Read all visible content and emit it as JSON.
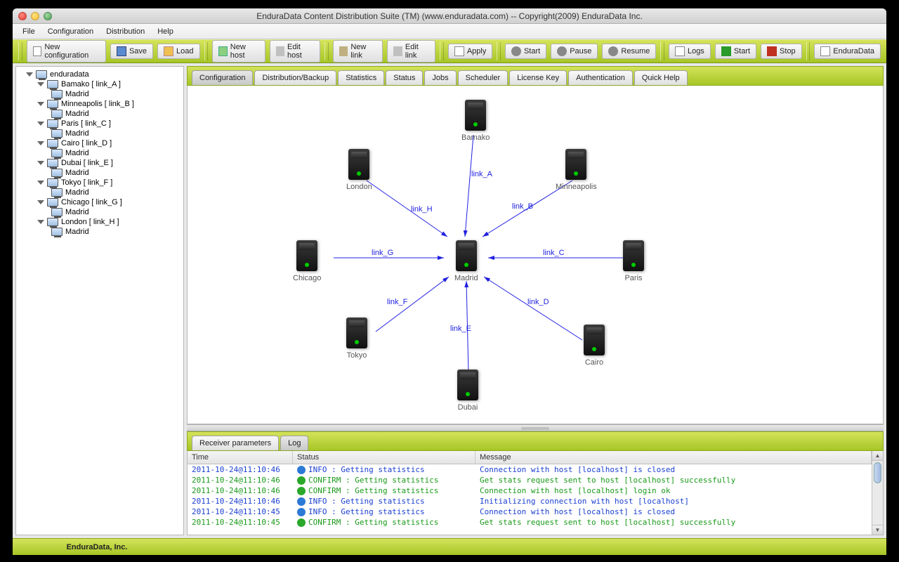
{
  "window": {
    "title": "EnduraData Content Distribution Suite (TM) (www.enduradata.com) -- Copyright(2009) EnduraData Inc."
  },
  "menu": {
    "file": "File",
    "configuration": "Configuration",
    "distribution": "Distribution",
    "help": "Help"
  },
  "toolbar": {
    "new_config": "New configuration",
    "save": "Save",
    "load": "Load",
    "new_host": "New host",
    "edit_host": "Edit host",
    "new_link": "New link",
    "edit_link": "Edit link",
    "apply": "Apply",
    "start": "Start",
    "pause": "Pause",
    "resume": "Resume",
    "logs": "Logs",
    "start2": "Start",
    "stop": "Stop",
    "brand": "EnduraData"
  },
  "tree": {
    "root": "enduradata",
    "nodes": [
      {
        "label": "Bamako [ link_A ]",
        "child": "Madrid"
      },
      {
        "label": "Minneapolis [ link_B ]",
        "child": "Madrid"
      },
      {
        "label": "Paris [ link_C ]",
        "child": "Madrid"
      },
      {
        "label": "Cairo [ link_D ]",
        "child": "Madrid"
      },
      {
        "label": "Dubai [ link_E ]",
        "child": "Madrid"
      },
      {
        "label": "Tokyo [ link_F ]",
        "child": "Madrid"
      },
      {
        "label": "Chicago [ link_G ]",
        "child": "Madrid"
      },
      {
        "label": "London [ link_H ]",
        "child": "Madrid"
      }
    ]
  },
  "tabs": {
    "items": [
      "Configuration",
      "Distribution/Backup",
      "Statistics",
      "Status",
      "Jobs",
      "Scheduler",
      "License Key",
      "Authentication",
      "Quick Help"
    ],
    "active": 0
  },
  "diagram": {
    "center": {
      "label": "Madrid"
    },
    "nodes": {
      "bamako": "Bamako",
      "london": "London",
      "minneapolis": "Minneapolis",
      "chicago": "Chicago",
      "paris": "Paris",
      "tokyo": "Tokyo",
      "cairo": "Cairo",
      "dubai": "Dubai"
    },
    "links": {
      "A": "link_A",
      "B": "link_B",
      "C": "link_C",
      "D": "link_D",
      "E": "link_E",
      "F": "link_F",
      "G": "link_G",
      "H": "link_H"
    }
  },
  "bottom_tabs": {
    "recv": "Receiver parameters",
    "log": "Log"
  },
  "log": {
    "headers": {
      "time": "Time",
      "status": "Status",
      "message": "Message"
    },
    "rows": [
      {
        "time": "2011-10-24@11:10:46",
        "kind": "info",
        "status": "INFO : Getting statistics",
        "msg": "Connection with host [localhost] is closed"
      },
      {
        "time": "2011-10-24@11:10:46",
        "kind": "confirm",
        "status": "CONFIRM : Getting statistics",
        "msg": "Get stats request sent to host [localhost] successfully"
      },
      {
        "time": "2011-10-24@11:10:46",
        "kind": "confirm",
        "status": "CONFIRM : Getting statistics",
        "msg": "Connection with host [localhost] login ok"
      },
      {
        "time": "2011-10-24@11:10:46",
        "kind": "info",
        "status": "INFO : Getting statistics",
        "msg": "Initializing connection with host [localhost]"
      },
      {
        "time": "2011-10-24@11:10:45",
        "kind": "info",
        "status": "INFO : Getting statistics",
        "msg": "Connection with host [localhost] is closed"
      },
      {
        "time": "2011-10-24@11:10:45",
        "kind": "confirm",
        "status": "CONFIRM : Getting statistics",
        "msg": "Get stats request sent to host [localhost] successfully"
      }
    ]
  },
  "footer": {
    "company": "EnduraData, Inc."
  }
}
